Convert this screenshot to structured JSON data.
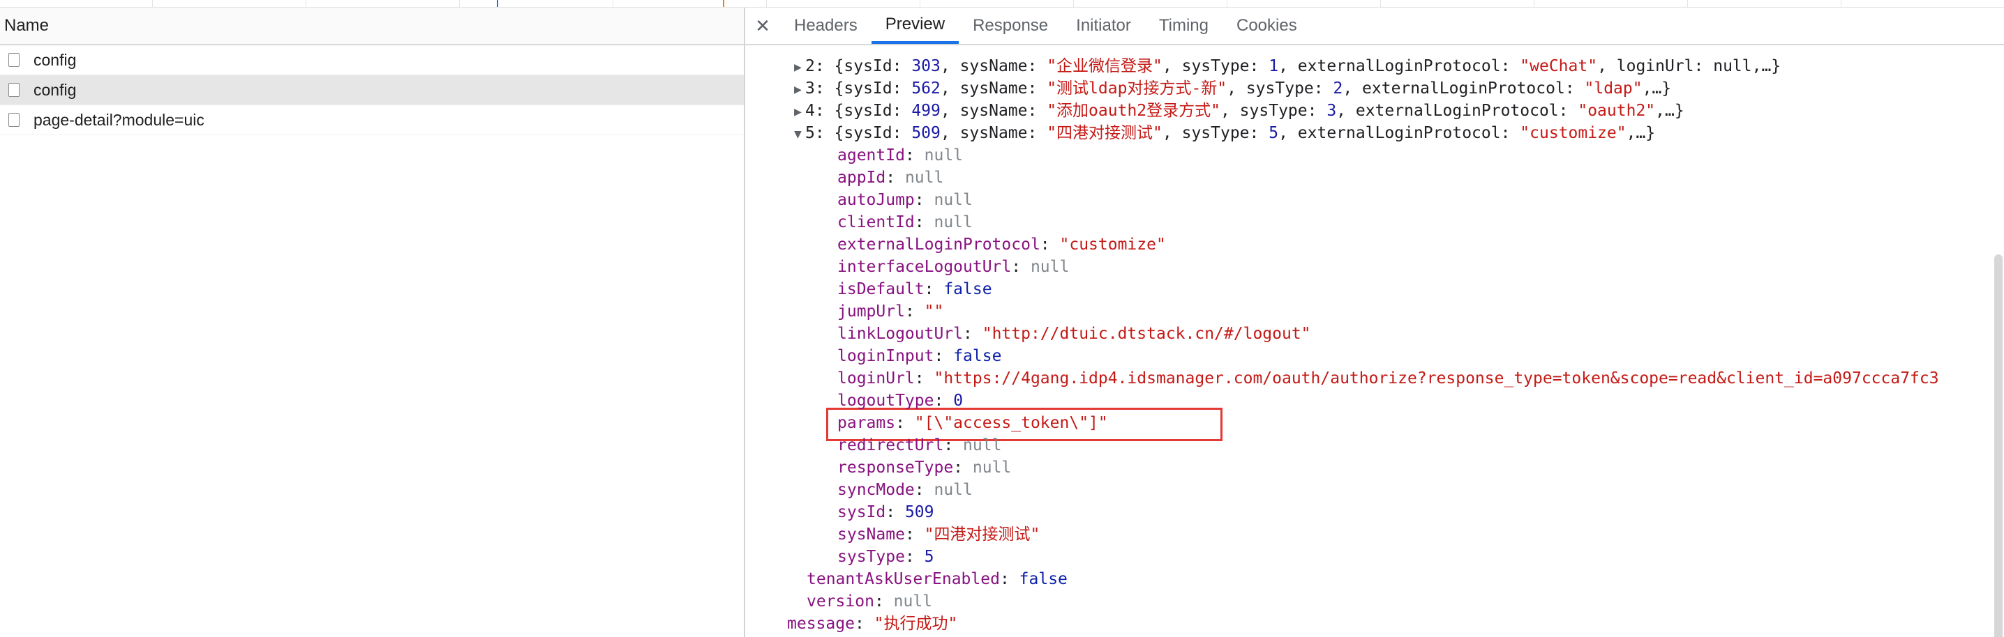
{
  "timeline": {},
  "requests_panel": {
    "header": "Name",
    "rows": [
      {
        "name": "config",
        "selected": false
      },
      {
        "name": "config",
        "selected": true
      },
      {
        "name": "page-detail?module=uic",
        "selected": false
      }
    ]
  },
  "tabs": {
    "close_icon": "close-icon",
    "items": [
      "Headers",
      "Preview",
      "Response",
      "Initiator",
      "Timing",
      "Cookies"
    ],
    "active": "Preview"
  },
  "preview": {
    "lines": [
      {
        "indent": 1,
        "arrow": "▶",
        "parts": [
          [
            "p",
            "2: "
          ],
          [
            "p",
            "{sysId: "
          ],
          [
            "n",
            "303"
          ],
          [
            "p",
            ", sysName: "
          ],
          [
            "s",
            "\"企业微信登录\""
          ],
          [
            "p",
            ", sysType: "
          ],
          [
            "n",
            "1"
          ],
          [
            "p",
            ", externalLoginProtocol: "
          ],
          [
            "s",
            "\"weChat\""
          ],
          [
            "p",
            ", loginUrl: null,…}"
          ]
        ]
      },
      {
        "indent": 1,
        "arrow": "▶",
        "parts": [
          [
            "p",
            "3: "
          ],
          [
            "p",
            "{sysId: "
          ],
          [
            "n",
            "562"
          ],
          [
            "p",
            ", sysName: "
          ],
          [
            "s",
            "\"测试ldap对接方式-新\""
          ],
          [
            "p",
            ", sysType: "
          ],
          [
            "n",
            "2"
          ],
          [
            "p",
            ", externalLoginProtocol: "
          ],
          [
            "s",
            "\"ldap\""
          ],
          [
            "p",
            ",…}"
          ]
        ]
      },
      {
        "indent": 1,
        "arrow": "▶",
        "parts": [
          [
            "p",
            "4: "
          ],
          [
            "p",
            "{sysId: "
          ],
          [
            "n",
            "499"
          ],
          [
            "p",
            ", sysName: "
          ],
          [
            "s",
            "\"添加oauth2登录方式\""
          ],
          [
            "p",
            ", sysType: "
          ],
          [
            "n",
            "3"
          ],
          [
            "p",
            ", externalLoginProtocol: "
          ],
          [
            "s",
            "\"oauth2\""
          ],
          [
            "p",
            ",…}"
          ]
        ]
      },
      {
        "indent": 1,
        "arrow": "▼",
        "parts": [
          [
            "p",
            "5: "
          ],
          [
            "p",
            "{sysId: "
          ],
          [
            "n",
            "509"
          ],
          [
            "p",
            ", sysName: "
          ],
          [
            "s",
            "\"四港对接测试\""
          ],
          [
            "p",
            ", sysType: "
          ],
          [
            "n",
            "5"
          ],
          [
            "p",
            ", externalLoginProtocol: "
          ],
          [
            "s",
            "\"customize\""
          ],
          [
            "p",
            ",…}"
          ]
        ]
      },
      {
        "indent": 2,
        "parts": [
          [
            "k",
            "agentId"
          ],
          [
            "p",
            ": "
          ],
          [
            "nul",
            "null"
          ]
        ]
      },
      {
        "indent": 2,
        "parts": [
          [
            "k",
            "appId"
          ],
          [
            "p",
            ": "
          ],
          [
            "nul",
            "null"
          ]
        ]
      },
      {
        "indent": 2,
        "parts": [
          [
            "k",
            "autoJump"
          ],
          [
            "p",
            ": "
          ],
          [
            "nul",
            "null"
          ]
        ]
      },
      {
        "indent": 2,
        "parts": [
          [
            "k",
            "clientId"
          ],
          [
            "p",
            ": "
          ],
          [
            "nul",
            "null"
          ]
        ]
      },
      {
        "indent": 2,
        "parts": [
          [
            "k",
            "externalLoginProtocol"
          ],
          [
            "p",
            ": "
          ],
          [
            "s",
            "\"customize\""
          ]
        ]
      },
      {
        "indent": 2,
        "parts": [
          [
            "k",
            "interfaceLogoutUrl"
          ],
          [
            "p",
            ": "
          ],
          [
            "nul",
            "null"
          ]
        ]
      },
      {
        "indent": 2,
        "parts": [
          [
            "k",
            "isDefault"
          ],
          [
            "p",
            ": "
          ],
          [
            "b",
            "false"
          ]
        ]
      },
      {
        "indent": 2,
        "parts": [
          [
            "k",
            "jumpUrl"
          ],
          [
            "p",
            ": "
          ],
          [
            "s",
            "\"\""
          ]
        ]
      },
      {
        "indent": 2,
        "parts": [
          [
            "k",
            "linkLogoutUrl"
          ],
          [
            "p",
            ": "
          ],
          [
            "s",
            "\"http://dtuic.dtstack.cn/#/logout\""
          ]
        ]
      },
      {
        "indent": 2,
        "parts": [
          [
            "k",
            "loginInput"
          ],
          [
            "p",
            ": "
          ],
          [
            "b",
            "false"
          ]
        ]
      },
      {
        "indent": 2,
        "parts": [
          [
            "k",
            "loginUrl"
          ],
          [
            "p",
            ": "
          ],
          [
            "s",
            "\"https://4gang.idp4.idsmanager.com/oauth/authorize?response_type=token&scope=read&client_id=a097ccca7fc3"
          ]
        ]
      },
      {
        "indent": 2,
        "parts": [
          [
            "k",
            "logoutType"
          ],
          [
            "p",
            ": "
          ],
          [
            "n",
            "0"
          ]
        ]
      },
      {
        "indent": 2,
        "parts": [
          [
            "k",
            "params"
          ],
          [
            "p",
            ": "
          ],
          [
            "s",
            "\"[\\\"access_token\\\"]\""
          ]
        ]
      },
      {
        "indent": 2,
        "parts": [
          [
            "k",
            "redirectUrl"
          ],
          [
            "p",
            ": "
          ],
          [
            "nul",
            "null"
          ]
        ]
      },
      {
        "indent": 2,
        "parts": [
          [
            "k",
            "responseType"
          ],
          [
            "p",
            ": "
          ],
          [
            "nul",
            "null"
          ]
        ]
      },
      {
        "indent": 2,
        "parts": [
          [
            "k",
            "syncMode"
          ],
          [
            "p",
            ": "
          ],
          [
            "nul",
            "null"
          ]
        ]
      },
      {
        "indent": 2,
        "parts": [
          [
            "k",
            "sysId"
          ],
          [
            "p",
            ": "
          ],
          [
            "n",
            "509"
          ]
        ]
      },
      {
        "indent": 2,
        "parts": [
          [
            "k",
            "sysName"
          ],
          [
            "p",
            ": "
          ],
          [
            "s",
            "\"四港对接测试\""
          ]
        ]
      },
      {
        "indent": 2,
        "parts": [
          [
            "k",
            "sysType"
          ],
          [
            "p",
            ": "
          ],
          [
            "n",
            "5"
          ]
        ]
      },
      {
        "indent": 1,
        "parts": [
          [
            "k",
            "tenantAskUserEnabled"
          ],
          [
            "p",
            ": "
          ],
          [
            "b",
            "false"
          ]
        ]
      },
      {
        "indent": 1,
        "parts": [
          [
            "k",
            "version"
          ],
          [
            "p",
            ": "
          ],
          [
            "nul",
            "null"
          ]
        ]
      },
      {
        "indent": 0,
        "parts": [
          [
            "k",
            "message"
          ],
          [
            "p",
            ": "
          ],
          [
            "s",
            "\"执行成功\""
          ]
        ]
      }
    ]
  },
  "colors": {
    "key": "#881280",
    "string": "#c41a16",
    "number": "#1a1aa6",
    "boolean": "#0d22aa",
    "null": "#80868b",
    "highlight_border": "#e53935",
    "active_tab_underline": "#1a73e8"
  }
}
